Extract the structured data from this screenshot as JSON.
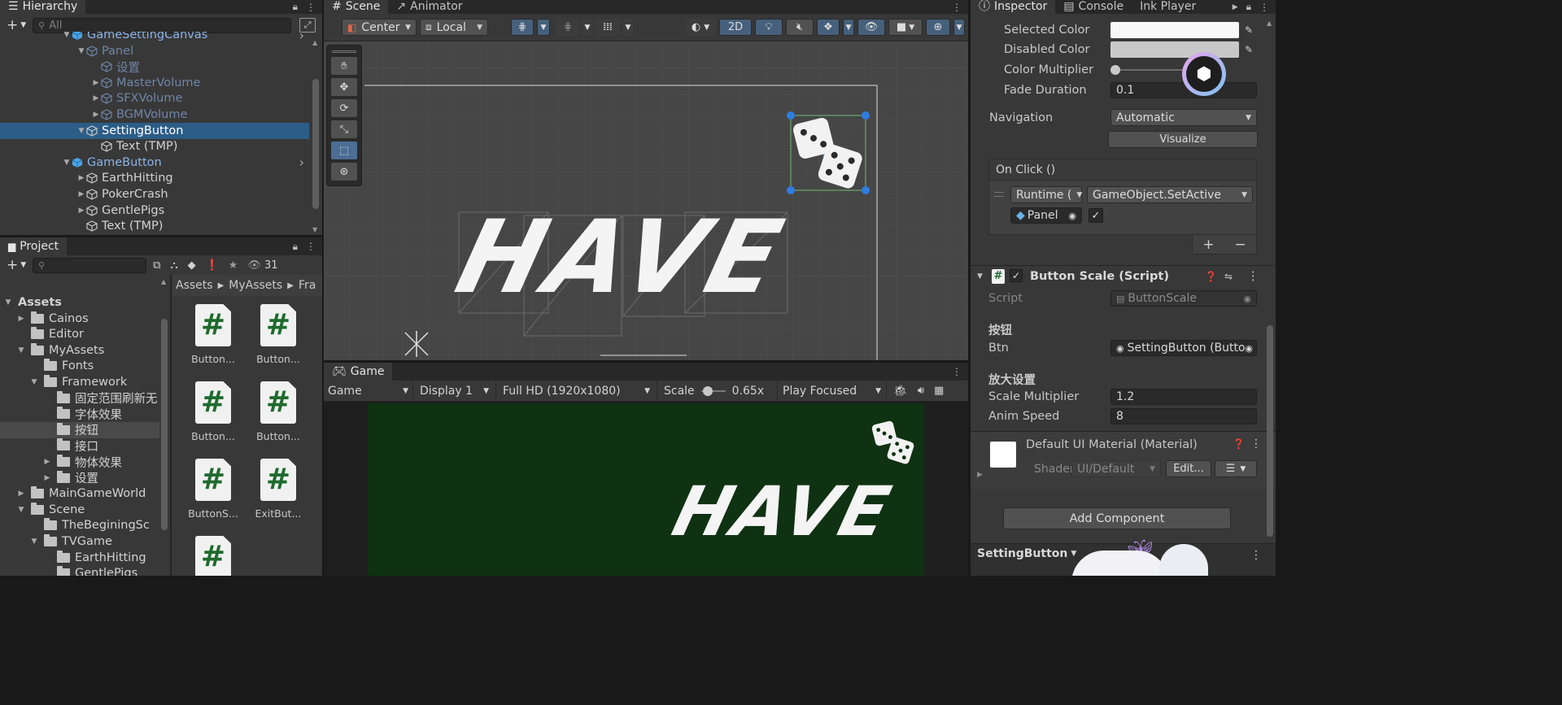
{
  "hierarchy": {
    "tab_label": "Hierarchy",
    "search_placeholder": "All",
    "items": [
      {
        "label": "GameSettingCanvas",
        "depth": 1,
        "arrow": "▼",
        "kind": "prefab",
        "state": "normal"
      },
      {
        "label": "Panel",
        "depth": 2,
        "arrow": "▼",
        "kind": "cube",
        "state": "dim"
      },
      {
        "label": "设置",
        "depth": 3,
        "arrow": "",
        "kind": "cube",
        "state": "dim"
      },
      {
        "label": "MasterVolume",
        "depth": 3,
        "arrow": "▶",
        "kind": "cube",
        "state": "dim"
      },
      {
        "label": "SFXVolume",
        "depth": 3,
        "arrow": "▶",
        "kind": "cube",
        "state": "dim"
      },
      {
        "label": "BGMVolume",
        "depth": 3,
        "arrow": "▶",
        "kind": "cube",
        "state": "dim"
      },
      {
        "label": "SettingButton",
        "depth": 2,
        "arrow": "▼",
        "kind": "cube",
        "state": "selected"
      },
      {
        "label": "Text (TMP)",
        "depth": 3,
        "arrow": "",
        "kind": "cube",
        "state": "normal"
      },
      {
        "label": "GameButton",
        "depth": 1,
        "arrow": "▼",
        "kind": "prefab",
        "state": "normal"
      },
      {
        "label": "EarthHitting",
        "depth": 2,
        "arrow": "▶",
        "kind": "cube",
        "state": "normal"
      },
      {
        "label": "PokerCrash",
        "depth": 2,
        "arrow": "▶",
        "kind": "cube",
        "state": "normal"
      },
      {
        "label": "GentlePigs",
        "depth": 2,
        "arrow": "▶",
        "kind": "cube",
        "state": "normal"
      },
      {
        "label": "Text (TMP)",
        "depth": 2,
        "arrow": "",
        "kind": "cube",
        "state": "normal"
      }
    ]
  },
  "project": {
    "tab_label": "Project",
    "hidden_count": "31",
    "tree": [
      {
        "label": "Assets",
        "depth": 0,
        "arrow": "▼",
        "bold": true,
        "selected": false
      },
      {
        "label": "Cainos",
        "depth": 1,
        "arrow": "▶",
        "bold": false,
        "selected": false
      },
      {
        "label": "Editor",
        "depth": 1,
        "arrow": "",
        "bold": false,
        "selected": false
      },
      {
        "label": "MyAssets",
        "depth": 1,
        "arrow": "▼",
        "bold": false,
        "selected": false
      },
      {
        "label": "Fonts",
        "depth": 2,
        "arrow": "",
        "bold": false,
        "selected": false
      },
      {
        "label": "Framework",
        "depth": 2,
        "arrow": "▼",
        "bold": false,
        "selected": false
      },
      {
        "label": "固定范围刷新无",
        "depth": 3,
        "arrow": "",
        "bold": false,
        "selected": false
      },
      {
        "label": "字体效果",
        "depth": 3,
        "arrow": "",
        "bold": false,
        "selected": false
      },
      {
        "label": "按钮",
        "depth": 3,
        "arrow": "",
        "bold": false,
        "selected": true
      },
      {
        "label": "接口",
        "depth": 3,
        "arrow": "",
        "bold": false,
        "selected": false
      },
      {
        "label": "物体效果",
        "depth": 3,
        "arrow": "▶",
        "bold": false,
        "selected": false
      },
      {
        "label": "设置",
        "depth": 3,
        "arrow": "▶",
        "bold": false,
        "selected": false
      },
      {
        "label": "MainGameWorld",
        "depth": 1,
        "arrow": "▶",
        "bold": false,
        "selected": false
      },
      {
        "label": "Scene",
        "depth": 1,
        "arrow": "▼",
        "bold": false,
        "selected": false
      },
      {
        "label": "TheBeginingSc",
        "depth": 2,
        "arrow": "",
        "bold": false,
        "selected": false
      },
      {
        "label": "TVGame",
        "depth": 2,
        "arrow": "▼",
        "bold": false,
        "selected": false
      },
      {
        "label": "EarthHitting",
        "depth": 3,
        "arrow": "",
        "bold": false,
        "selected": false
      },
      {
        "label": "GentlePigs",
        "depth": 3,
        "arrow": "",
        "bold": false,
        "selected": false
      }
    ],
    "breadcrumb": [
      "Assets",
      "MyAssets",
      "Fra"
    ],
    "assets": [
      {
        "label": "Button..."
      },
      {
        "label": "Button..."
      },
      {
        "label": "Button..."
      },
      {
        "label": "Button..."
      },
      {
        "label": "ButtonS..."
      },
      {
        "label": "ExitBut..."
      },
      {
        "label": ""
      }
    ]
  },
  "scene": {
    "tab_label": "Scene",
    "tab2_label": "Animator",
    "pivot": "Center",
    "space": "Local",
    "mode_2d": "2D",
    "canvas_text": "HAVE"
  },
  "game": {
    "tab_label": "Game",
    "view": "Game",
    "display": "Display 1",
    "resolution": "Full HD (1920x1080)",
    "scale_label": "Scale",
    "scale_value": "0.65x",
    "scale_fraction": 0.15,
    "play_mode": "Play Focused",
    "canvas_text": "HAVE",
    "bg_color": "#0f3212"
  },
  "inspector": {
    "tabs": [
      "Inspector",
      "Console",
      "Ink Player"
    ],
    "selected_color_label": "Selected Color",
    "disabled_color_label": "Disabled Color",
    "color_multiplier_label": "Color Multiplier",
    "color_multiplier_fraction": 0.0,
    "fade_duration_label": "Fade Duration",
    "fade_duration_value": "0.1",
    "navigation_label": "Navigation",
    "navigation_value": "Automatic",
    "visualize_label": "Visualize",
    "onclick_label": "On Click ()",
    "runtime_value": "Runtime (",
    "method_value": "GameObject.SetActive",
    "target_value": "Panel",
    "plus": "+",
    "minus": "−",
    "component_title": "Button Scale (Script)",
    "script_label": "Script",
    "script_value": "ButtonScale",
    "section_button": "按钮",
    "btn_label": "Btn",
    "btn_value": "SettingButton (Butto",
    "section_scale": "放大设置",
    "scale_mult_label": "Scale Multiplier",
    "scale_mult_value": "1.2",
    "anim_speed_label": "Anim Speed",
    "anim_speed_value": "8",
    "material_title": "Default UI Material (Material)",
    "shader_label": "Shader",
    "shader_value": "UI/Default",
    "edit_label": "Edit...",
    "add_component_label": "Add Component",
    "footer_object": "SettingButton"
  },
  "colors": {
    "selection": "#2c5d87",
    "accent_blue": "#3a79bb",
    "game_bg": "#0f3212",
    "script_hash": "#1f6b2e"
  }
}
